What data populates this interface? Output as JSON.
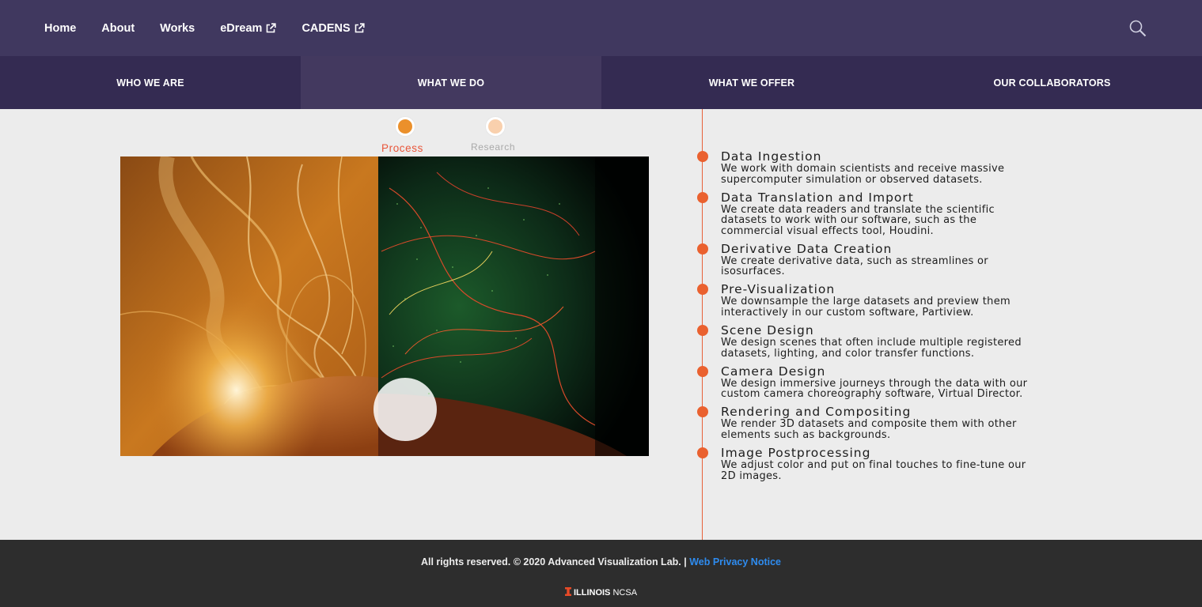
{
  "nav": {
    "items": [
      {
        "label": "Home",
        "external": false
      },
      {
        "label": "About",
        "external": false
      },
      {
        "label": "Works",
        "external": false
      },
      {
        "label": "eDream",
        "external": true
      },
      {
        "label": "CADENS",
        "external": true
      }
    ],
    "search_icon": "search-icon"
  },
  "tabs": [
    {
      "label": "WHO WE ARE",
      "active": false
    },
    {
      "label": "WHAT WE DO",
      "active": true
    },
    {
      "label": "WHAT WE OFFER",
      "active": false
    },
    {
      "label": "OUR COLLABORATORS",
      "active": false
    }
  ],
  "toggle": {
    "process_label": "Process",
    "research_label": "Research",
    "selected": "Process"
  },
  "steps": [
    {
      "title": "Data Ingestion",
      "lines": [
        "We work with domain scientists and receive massive",
        "supercomputer simulation or observed datasets."
      ]
    },
    {
      "title": "Data Translation and Import",
      "lines": [
        "We create data readers and translate the scientific",
        "datasets to work with our software, such as the",
        "commercial visual effects tool, Houdini."
      ]
    },
    {
      "title": "Derivative Data Creation",
      "lines": [
        "We create derivative data, such as streamlines or",
        "isosurfaces."
      ]
    },
    {
      "title": "Pre-Visualization",
      "lines": [
        "We downsample the large datasets and preview them",
        "interactively in our custom software, Partiview."
      ]
    },
    {
      "title": "Scene Design",
      "lines": [
        "We design scenes that often include multiple registered",
        "datasets, lighting, and color transfer functions."
      ]
    },
    {
      "title": "Camera Design",
      "lines": [
        "We design immersive journeys through the data with our",
        "custom camera choreography software, Virtual Director."
      ]
    },
    {
      "title": "Rendering and Compositing",
      "lines": [
        "We render 3D datasets and composite them with other",
        "elements such as backgrounds."
      ]
    },
    {
      "title": "Image Postprocessing",
      "lines": [
        "We adjust color and put on final touches to fine-tune our",
        "2D images."
      ]
    }
  ],
  "footer": {
    "copyright": "All rights reserved. © 2020 Advanced Visualization Lab. | ",
    "privacy_link": "Web Privacy Notice",
    "brand_bold": "ILLINOIS",
    "brand_rest": "NCSA"
  },
  "colors": {
    "nav_bg": "#40385f",
    "tabs_bg": "#342b52",
    "accent": "#ea612f",
    "footer_bg": "#2d2d2d",
    "link": "#2e8cf0"
  }
}
